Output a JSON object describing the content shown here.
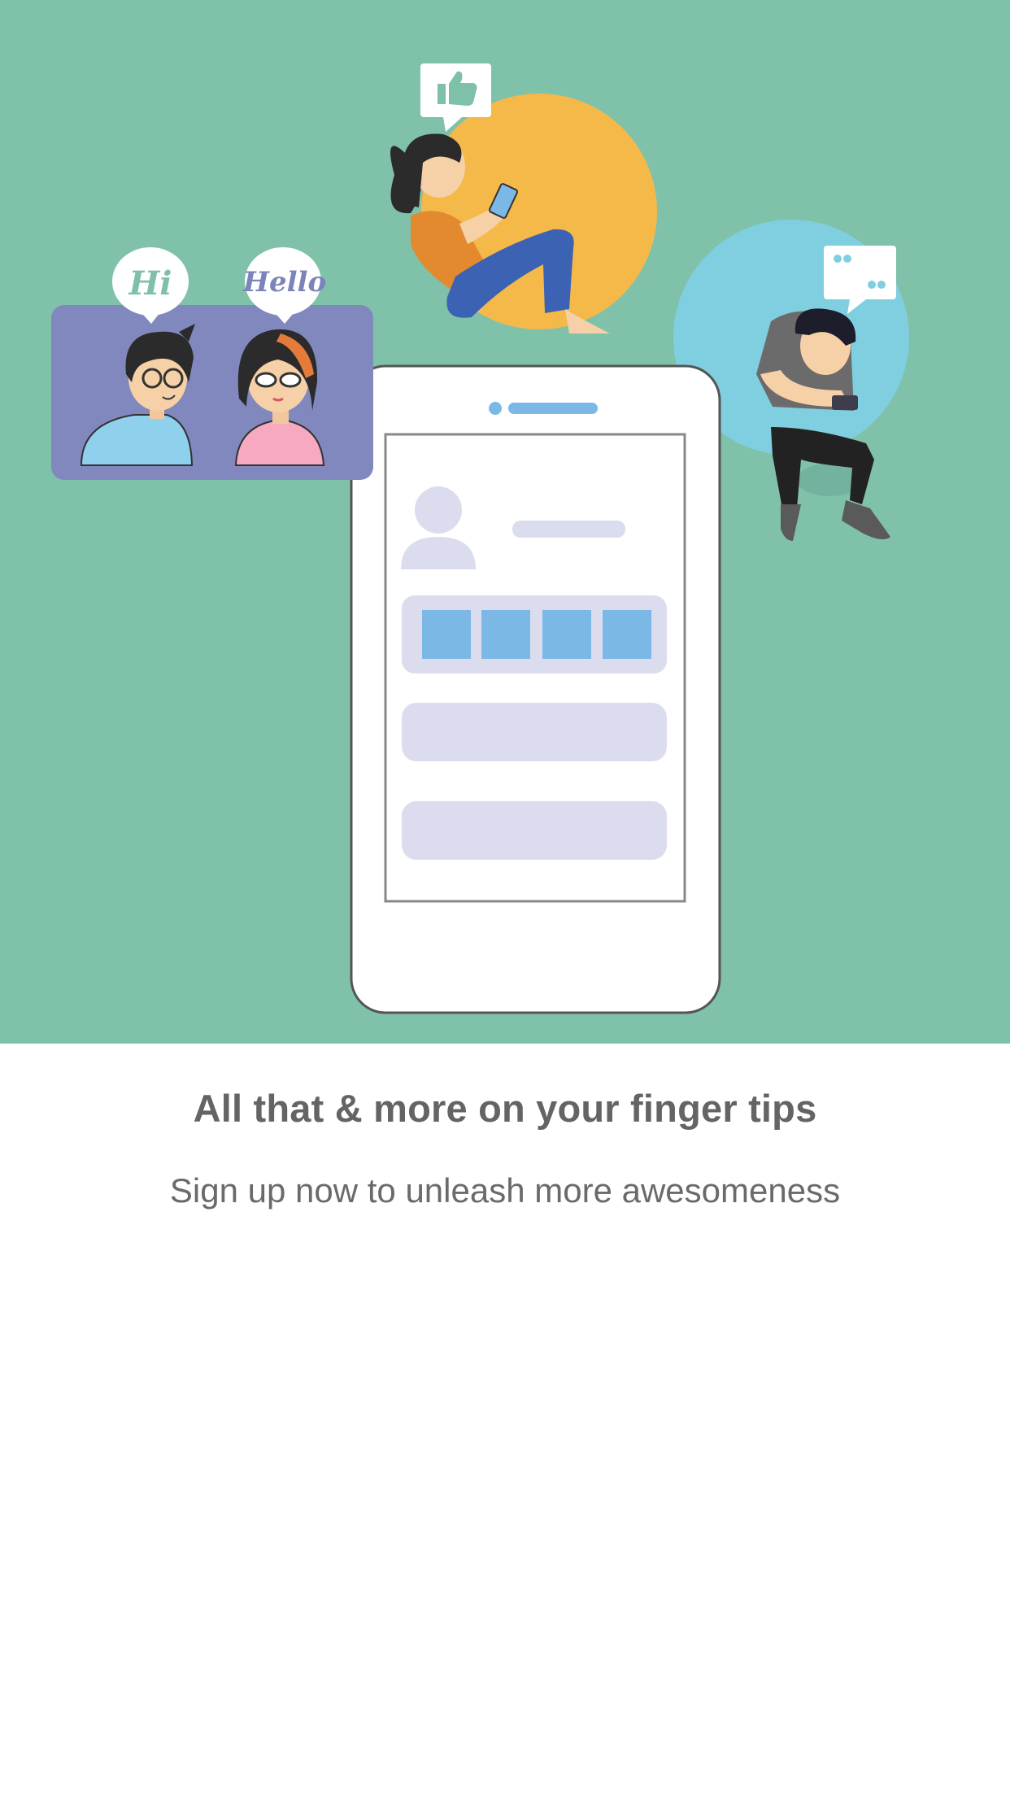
{
  "onboarding": {
    "title": "All that & more on your finger tips",
    "subtitle": "Sign up now to unleash more awesomeness",
    "illustration": {
      "greeting_left": "Hi",
      "greeting_right": "Hello",
      "icons": [
        "thumbs-up-icon",
        "quote-icon",
        "user-avatar-icon"
      ]
    },
    "colors": {
      "hero_background": "#80c1aa",
      "yellow_circle": "#f5b94a",
      "blue_circle": "#7fcfe0",
      "chat_card": "#8088be",
      "placeholder": "#dcdcef",
      "tile": "#7bb8e6",
      "text": "#646464"
    }
  }
}
